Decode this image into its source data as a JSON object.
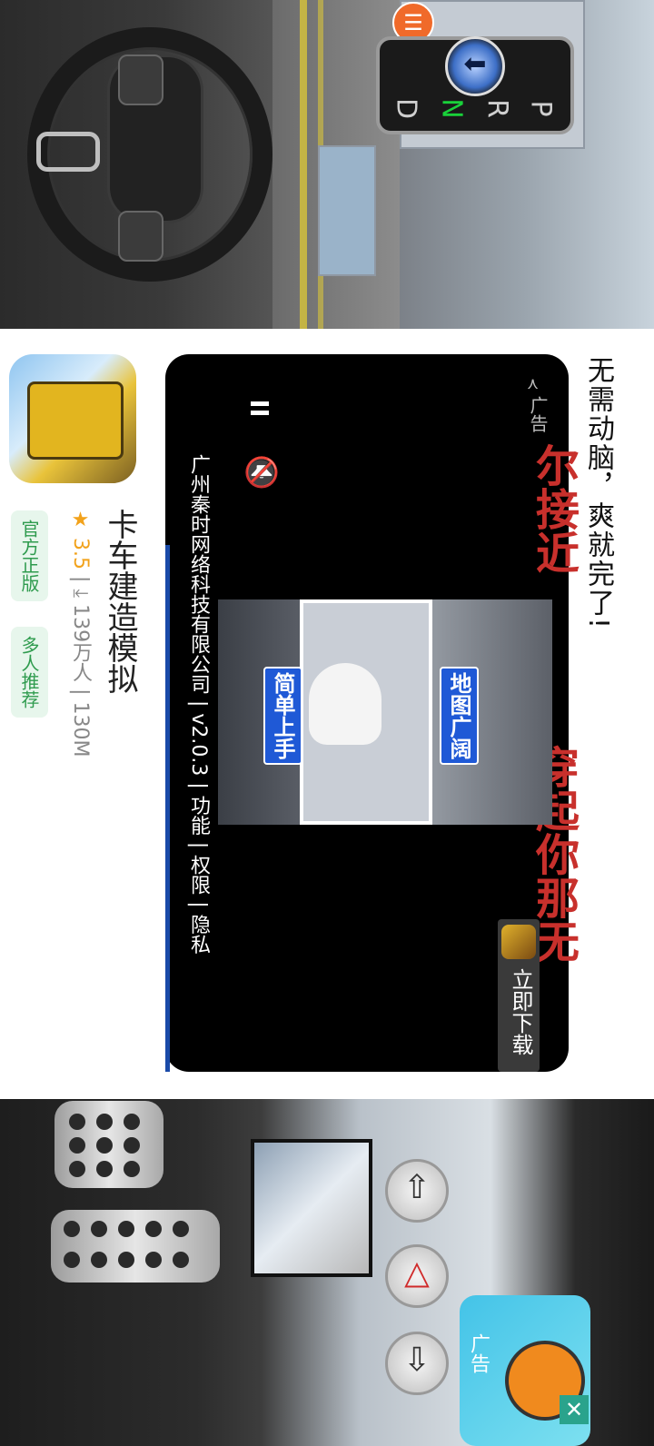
{
  "game_top": {
    "menu_icon": "hamburger-icon",
    "gear_knob_icon": "arrow-left-icon",
    "gears": [
      "D",
      "N",
      "R",
      "P"
    ],
    "active_gear": "N",
    "active_gear_color": "#19d23a"
  },
  "ad": {
    "headline": "无需动脑，爽就完了!",
    "ad_label": "广告",
    "red_text_1": "尔接近",
    "red_text_2": "穿起你那无",
    "video_tag_1": "地图广阔",
    "video_tag_2": "简单上手",
    "company": "广州秦时网络科技有限公司",
    "version": "v2.0.3",
    "links": [
      "功能",
      "权限",
      "隐私"
    ],
    "download_label": "立即下载",
    "accent_red": "#c8302c",
    "accent_blue": "#1f59d6"
  },
  "app": {
    "name": "卡车建造模拟",
    "rating": "3.5",
    "downloads": "139万人",
    "size": "130M",
    "badges": [
      "官方正版",
      "多人推荐"
    ],
    "badge_color": "#2f9b4e"
  },
  "game_bottom": {
    "up_arrow": "⇧",
    "hazard": "△",
    "down_arrow": "⇩",
    "float_ad_label": "广告",
    "close_label": "✕"
  }
}
